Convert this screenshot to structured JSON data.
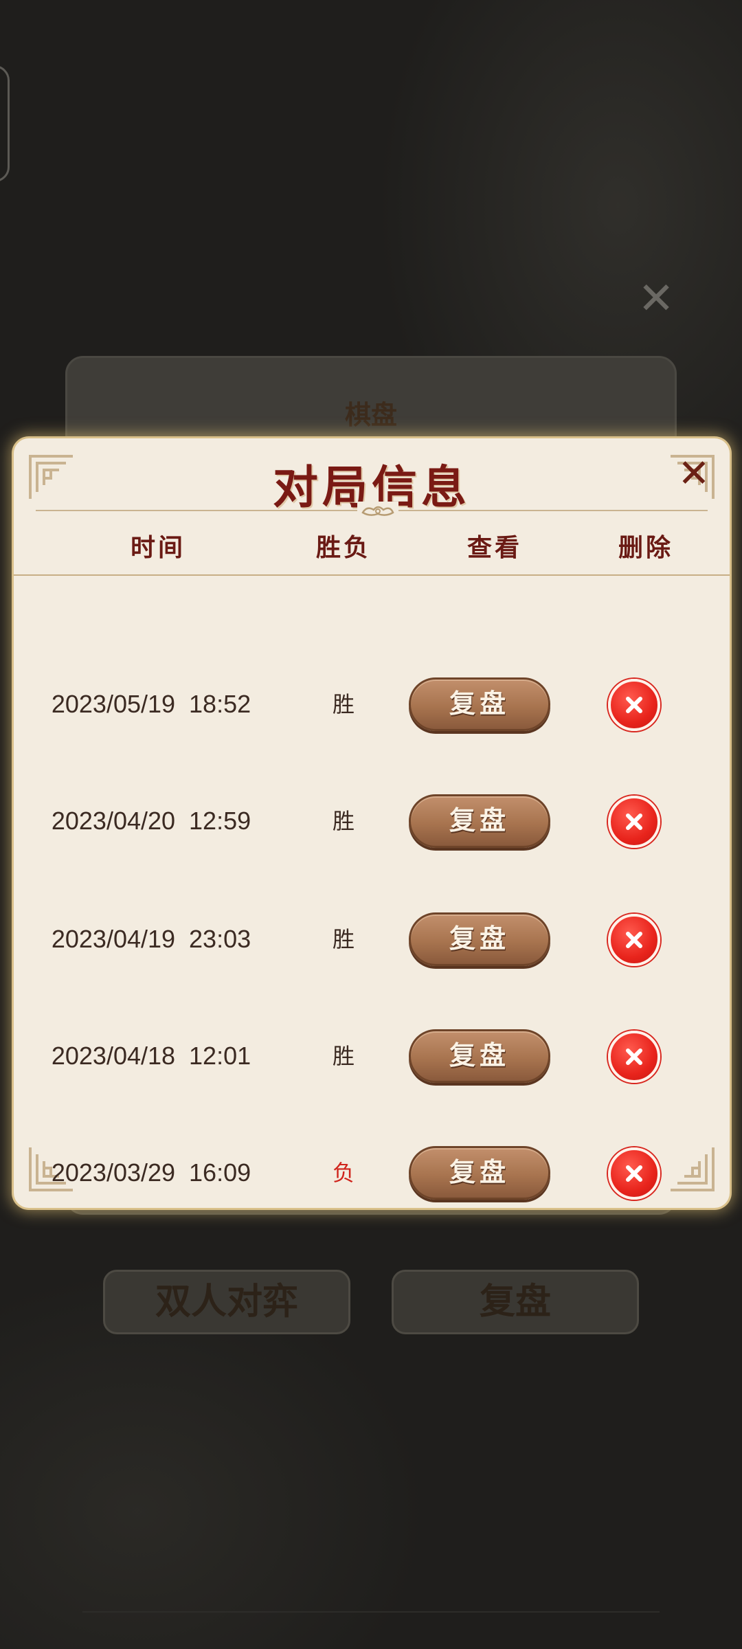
{
  "background": {
    "panel_title": "棋盘",
    "bottom_buttons": {
      "left_label": "双人对弈",
      "right_label": "复盘"
    }
  },
  "dialog": {
    "title": "对局信息",
    "close_icon": "close-icon",
    "columns": {
      "time": "时间",
      "result": "胜负",
      "view": "查看",
      "delete": "删除"
    },
    "rows": [
      {
        "time": "2023/05/19  18:52",
        "result": "胜",
        "result_type": "win",
        "replay_label": "复盘"
      },
      {
        "time": "2023/04/20  12:59",
        "result": "胜",
        "result_type": "win",
        "replay_label": "复盘"
      },
      {
        "time": "2023/04/19  23:03",
        "result": "胜",
        "result_type": "win",
        "replay_label": "复盘"
      },
      {
        "time": "2023/04/18  12:01",
        "result": "胜",
        "result_type": "win",
        "replay_label": "复盘"
      },
      {
        "time": "2023/03/29  16:09",
        "result": "负",
        "result_type": "loss",
        "replay_label": "复盘"
      }
    ]
  },
  "colors": {
    "title": "#7a1a14",
    "loss": "#d0241c",
    "replay_button": "#a8744f",
    "delete_button": "#e8241c",
    "dialog_bg": "#f3ece0"
  }
}
